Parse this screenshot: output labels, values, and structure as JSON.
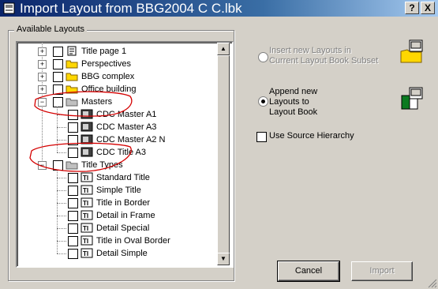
{
  "window": {
    "title": "Import Layout from BBG2004 C C.lbk",
    "help_label": "?",
    "close_label": "X"
  },
  "group_label": "Available Layouts",
  "tree": [
    {
      "label": "Title page 1",
      "icon": "layout-book-icon",
      "expander": "+"
    },
    {
      "label": "Perspectives",
      "icon": "folder-icon",
      "expander": "+"
    },
    {
      "label": "BBG complex",
      "icon": "folder-icon",
      "expander": "+"
    },
    {
      "label": "Office building",
      "icon": "folder-icon",
      "expander": "+"
    },
    {
      "label": "Masters",
      "icon": "folder-gray-icon",
      "expander": "-"
    },
    {
      "label": "CDC Master A1",
      "icon": "master-icon"
    },
    {
      "label": "CDC Master A3",
      "icon": "master-icon"
    },
    {
      "label": "CDC Master A2 N",
      "icon": "master-icon"
    },
    {
      "label": "CDC Title A3",
      "icon": "master-icon"
    },
    {
      "label": "Title Types",
      "icon": "folder-gray-icon",
      "expander": "-"
    },
    {
      "label": "Standard Title",
      "icon": "title-type-icon"
    },
    {
      "label": "Simple Title",
      "icon": "title-type-icon"
    },
    {
      "label": "Title in Border",
      "icon": "title-type-icon"
    },
    {
      "label": "Detail in Frame",
      "icon": "title-type-icon"
    },
    {
      "label": "Detail Special",
      "icon": "title-type-icon"
    },
    {
      "label": "Title in Oval Border",
      "icon": "title-type-icon"
    },
    {
      "label": "Detail Simple",
      "icon": "title-type-icon"
    }
  ],
  "options": {
    "insert_label": "Insert new Layouts in\nCurrent Layout Book Subset",
    "append_label": "Append new\nLayouts to\nLayout Book",
    "source_hierarchy_label": "Use Source Hierarchy",
    "selected": "append",
    "use_source_hierarchy": false
  },
  "buttons": {
    "cancel": "Cancel",
    "import": "Import"
  },
  "annotation_color": "#d40000"
}
